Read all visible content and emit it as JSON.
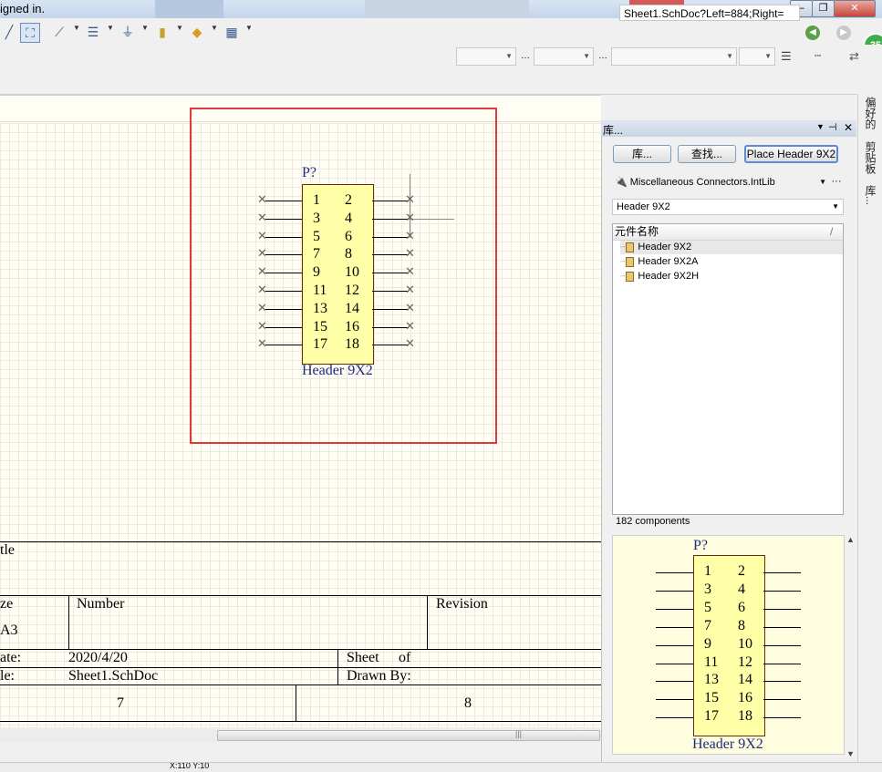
{
  "window": {
    "signed_in_text": "igned in.",
    "minimize": "‒",
    "restore": "❐",
    "close": "✕"
  },
  "toolbar": {
    "document_path": "Sheet1.SchDoc?Left=884;Right=",
    "badge_value": "35"
  },
  "schematic": {
    "component": {
      "designator": "P?",
      "comment": "Header 9X2",
      "left_pins": [
        "1",
        "3",
        "5",
        "7",
        "9",
        "11",
        "13",
        "15",
        "17"
      ],
      "right_pins": [
        "2",
        "4",
        "6",
        "8",
        "10",
        "12",
        "14",
        "16",
        "18"
      ]
    },
    "title_block": {
      "title_label": "tle",
      "size_label": "ze",
      "size_value": "A3",
      "number_label": "Number",
      "revision_label": "Revision",
      "date_label": "ate:",
      "date_value": "2020/4/20",
      "file_label": "le:",
      "file_value": "Sheet1.SchDoc",
      "sheet_label": "Sheet",
      "of_label": "of",
      "drawn_by_label": "Drawn By:",
      "zone_left": "7",
      "zone_right": "8"
    }
  },
  "library_panel": {
    "title": "库...",
    "libraries_button": "库...",
    "search_button": "查找...",
    "place_button": "Place Header 9X2",
    "library_selected": "Miscellaneous Connectors.IntLib",
    "library_more": "···",
    "filter_value": "Header 9X2",
    "column_header": "元件名称",
    "sort_indicator": "/",
    "components": [
      "Header 9X2",
      "Header 9X2A",
      "Header 9X2H"
    ],
    "count_text": "182 components",
    "preview": {
      "designator": "P?",
      "comment": "Header 9X2",
      "left_pins": [
        "1",
        "3",
        "5",
        "7",
        "9",
        "11",
        "13",
        "15",
        "17"
      ],
      "right_pins": [
        "2",
        "4",
        "6",
        "8",
        "10",
        "12",
        "14",
        "16",
        "18"
      ]
    }
  },
  "side_tabs": [
    "偏好的",
    "剪贴板",
    "库..."
  ],
  "status_bar": {
    "coords": "X:110 Y:10"
  },
  "colors": {
    "highlight_box": "#e0393c",
    "component_fill": "#ffffa8",
    "designator_text": "#1f2a80",
    "sheet_background": "#fffdf4"
  }
}
